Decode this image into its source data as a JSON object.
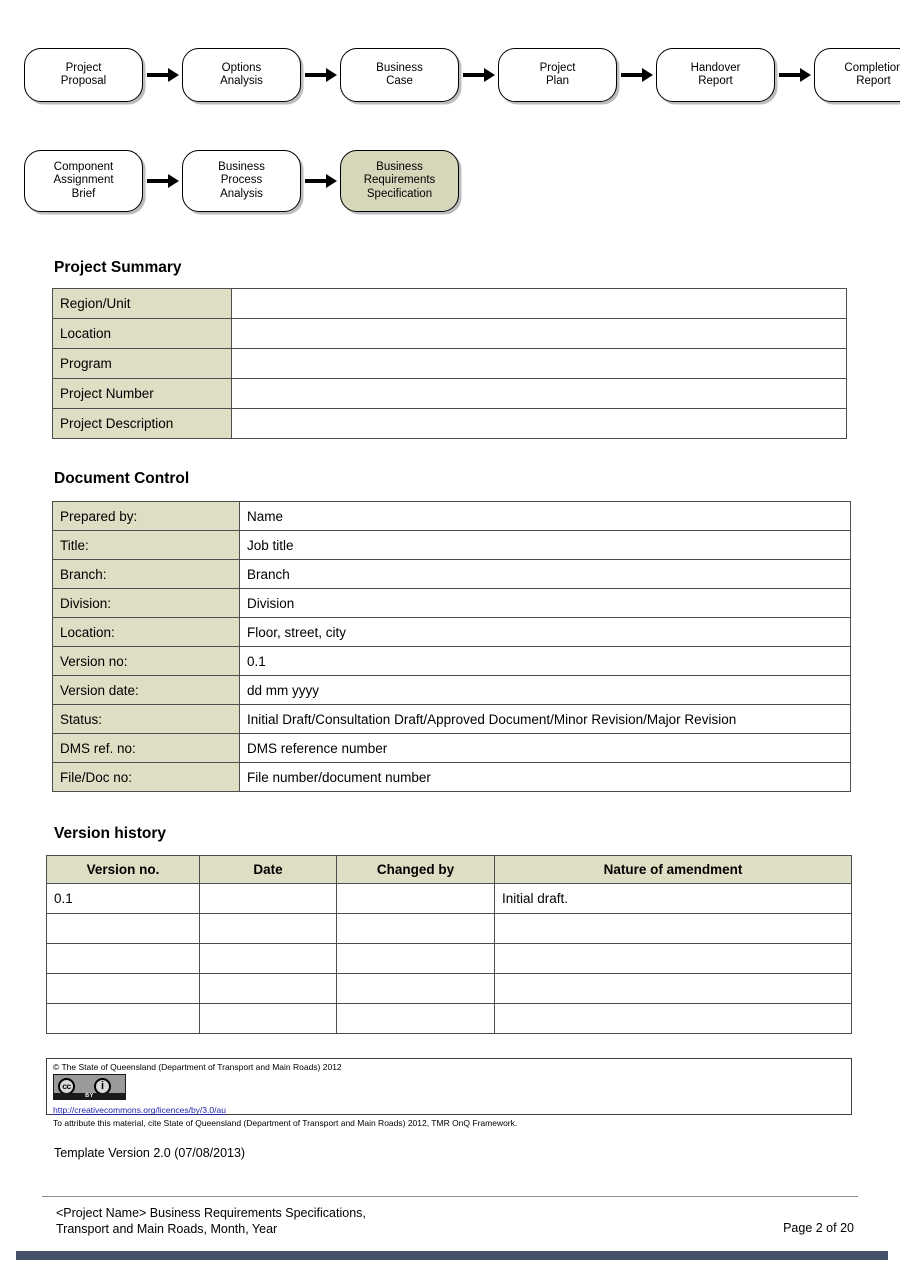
{
  "flow_diagram": {
    "row1": [
      {
        "label_lines": [
          "Project",
          "Proposal"
        ],
        "highlighted": false
      },
      {
        "label_lines": [
          "Options",
          "Analysis"
        ],
        "highlighted": false
      },
      {
        "label_lines": [
          "Business",
          "Case"
        ],
        "highlighted": false
      },
      {
        "label_lines": [
          "Project",
          "Plan"
        ],
        "highlighted": false
      },
      {
        "label_lines": [
          "Handover",
          "Report"
        ],
        "highlighted": false
      },
      {
        "label_lines": [
          "Completion",
          "Report"
        ],
        "highlighted": false
      }
    ],
    "row2": [
      {
        "label_lines": [
          "Component",
          "Assignment",
          "Brief"
        ],
        "highlighted": false
      },
      {
        "label_lines": [
          "Business",
          "Process",
          "Analysis"
        ],
        "highlighted": false
      },
      {
        "label_lines": [
          "Business",
          "Requirements",
          "Specification"
        ],
        "highlighted": true
      }
    ],
    "highlight_color": "#d6d6bb"
  },
  "project_summary": {
    "heading": "Project Summary",
    "rows": [
      {
        "label": "Region/Unit",
        "value": ""
      },
      {
        "label": "Location",
        "value": ""
      },
      {
        "label": "Program",
        "value": ""
      },
      {
        "label": "Project Number",
        "value": ""
      },
      {
        "label": "Project Description",
        "value": ""
      }
    ]
  },
  "document_control": {
    "heading": "Document Control",
    "rows": [
      {
        "label": "Prepared by:",
        "value": "Name"
      },
      {
        "label": "Title:",
        "value": "Job title"
      },
      {
        "label": "Branch:",
        "value": "Branch"
      },
      {
        "label": "Division:",
        "value": "Division"
      },
      {
        "label": "Location:",
        "value": "Floor, street, city"
      },
      {
        "label": "Version no:",
        "value": "0.1"
      },
      {
        "label": "Version date:",
        "value": "dd mm yyyy"
      },
      {
        "label": "Status:",
        "value": "Initial Draft/Consultation Draft/Approved Document/Minor Revision/Major Revision"
      },
      {
        "label": "DMS ref. no:",
        "value": "DMS reference number"
      },
      {
        "label": "File/Doc no:",
        "value": "File number/document number"
      }
    ]
  },
  "version_history": {
    "heading": "Version history",
    "columns": [
      "Version no.",
      "Date",
      "Changed by",
      "Nature of amendment"
    ],
    "rows": [
      [
        "0.1",
        "",
        "",
        "Initial draft."
      ],
      [
        "",
        "",
        "",
        ""
      ],
      [
        "",
        "",
        "",
        ""
      ],
      [
        "",
        "",
        "",
        ""
      ],
      [
        "",
        "",
        "",
        ""
      ]
    ]
  },
  "copyright": {
    "statement": "© The State of Queensland (Department of Transport and Main Roads) 2012",
    "license_url": "http://creativecommons.org/licences/by/3.0/au",
    "attribution": "To attribute this material, cite State of Queensland (Department of Transport and Main Roads) 2012, TMR OnQ Framework.",
    "badge": {
      "cc_glyph": "cc",
      "by_glyph": "i",
      "label": "BY"
    }
  },
  "template_version": "Template Version 2.0 (07/08/2013)",
  "footer": {
    "doc_title_line1": "<Project Name> Business Requirements Specifications,",
    "doc_title_line2": "Transport and Main Roads, Month, Year",
    "page_number": "Page 2 of 20",
    "bar_color": "#445068"
  }
}
